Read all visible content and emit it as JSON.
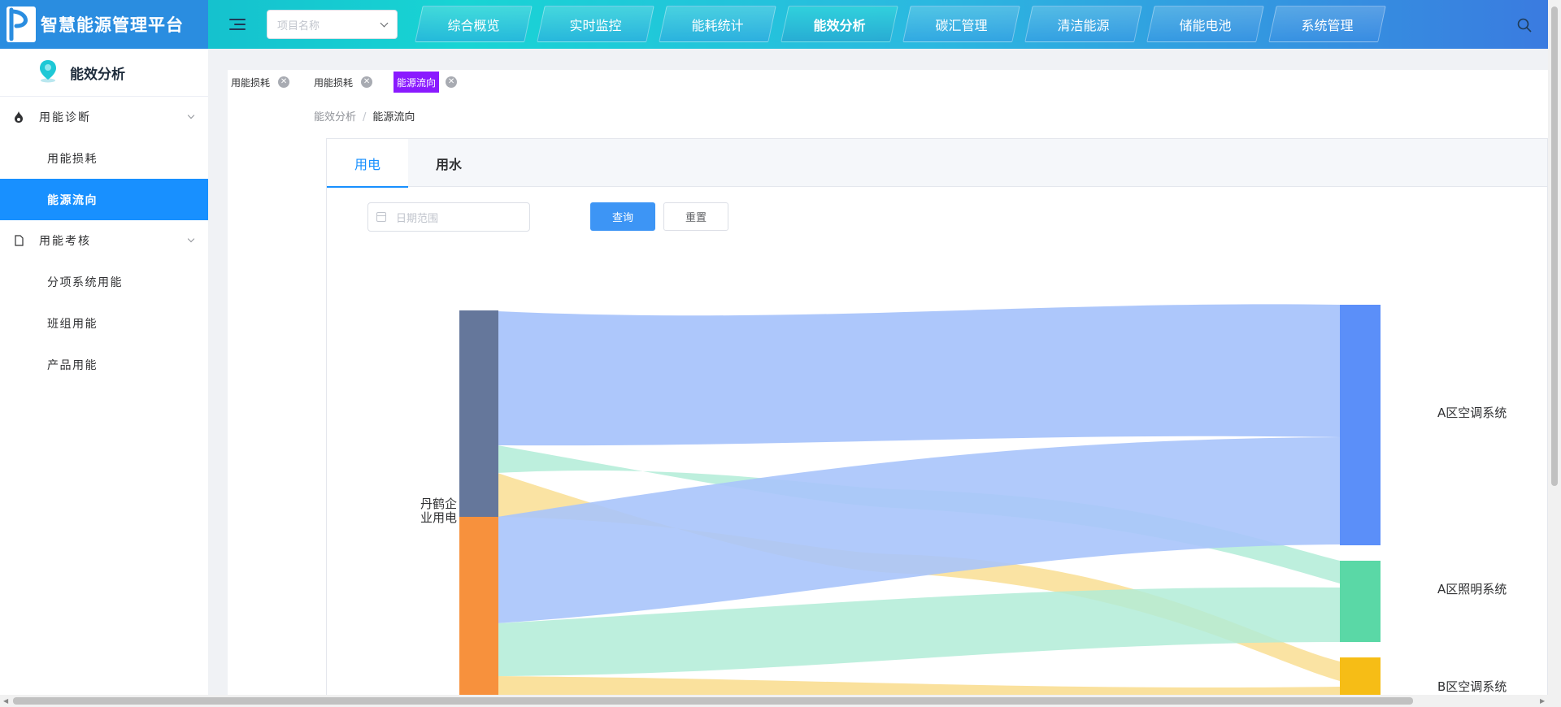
{
  "app": {
    "title": "智慧能源管理平台"
  },
  "header": {
    "project_placeholder": "项目名称",
    "nav": [
      {
        "label": "综合概览"
      },
      {
        "label": "实时监控"
      },
      {
        "label": "能耗统计"
      },
      {
        "label": "能效分析",
        "active": true
      },
      {
        "label": "碳汇管理"
      },
      {
        "label": "清洁能源"
      },
      {
        "label": "储能电池"
      },
      {
        "label": "系统管理"
      }
    ]
  },
  "sidebar": {
    "title": "能效分析",
    "groups": [
      {
        "label": "用能诊断",
        "icon": "flame-icon",
        "items": [
          {
            "label": "用能损耗"
          },
          {
            "label": "能源流向",
            "active": true
          }
        ]
      },
      {
        "label": "用能考核",
        "icon": "document-icon",
        "items": [
          {
            "label": "分项系统用能"
          },
          {
            "label": "班组用能"
          },
          {
            "label": "产品用能"
          }
        ]
      }
    ]
  },
  "tags": [
    {
      "label": "用能损耗"
    },
    {
      "label": "用能损耗"
    },
    {
      "label": "能源流向",
      "active": true
    }
  ],
  "breadcrumb": {
    "parent": "能效分析",
    "sep": "/",
    "current": "能源流向"
  },
  "tabs": [
    {
      "label": "用电",
      "active": true
    },
    {
      "label": "用水"
    }
  ],
  "filters": {
    "date_placeholder": "日期范围",
    "query_label": "查询",
    "reset_label": "重置"
  },
  "colors": {
    "accent": "#1890ff",
    "source1": "#65779b",
    "source2": "#f7913d",
    "target1": "#5b8ff9",
    "target2": "#5ad8a6",
    "target3": "#f6bd16",
    "flow_blue": "#a9c4fb",
    "flow_green": "#b2ecd7",
    "flow_yellow": "#f9dc8c"
  },
  "chart_data": {
    "type": "sankey",
    "nodes": [
      {
        "name": "丹鹤企业用电"
      },
      {
        "name": "A区空调系统"
      },
      {
        "name": "A区照明系统"
      },
      {
        "name": "B区空调系统"
      }
    ],
    "source_label": "丹鹤企\n业用电"
  }
}
